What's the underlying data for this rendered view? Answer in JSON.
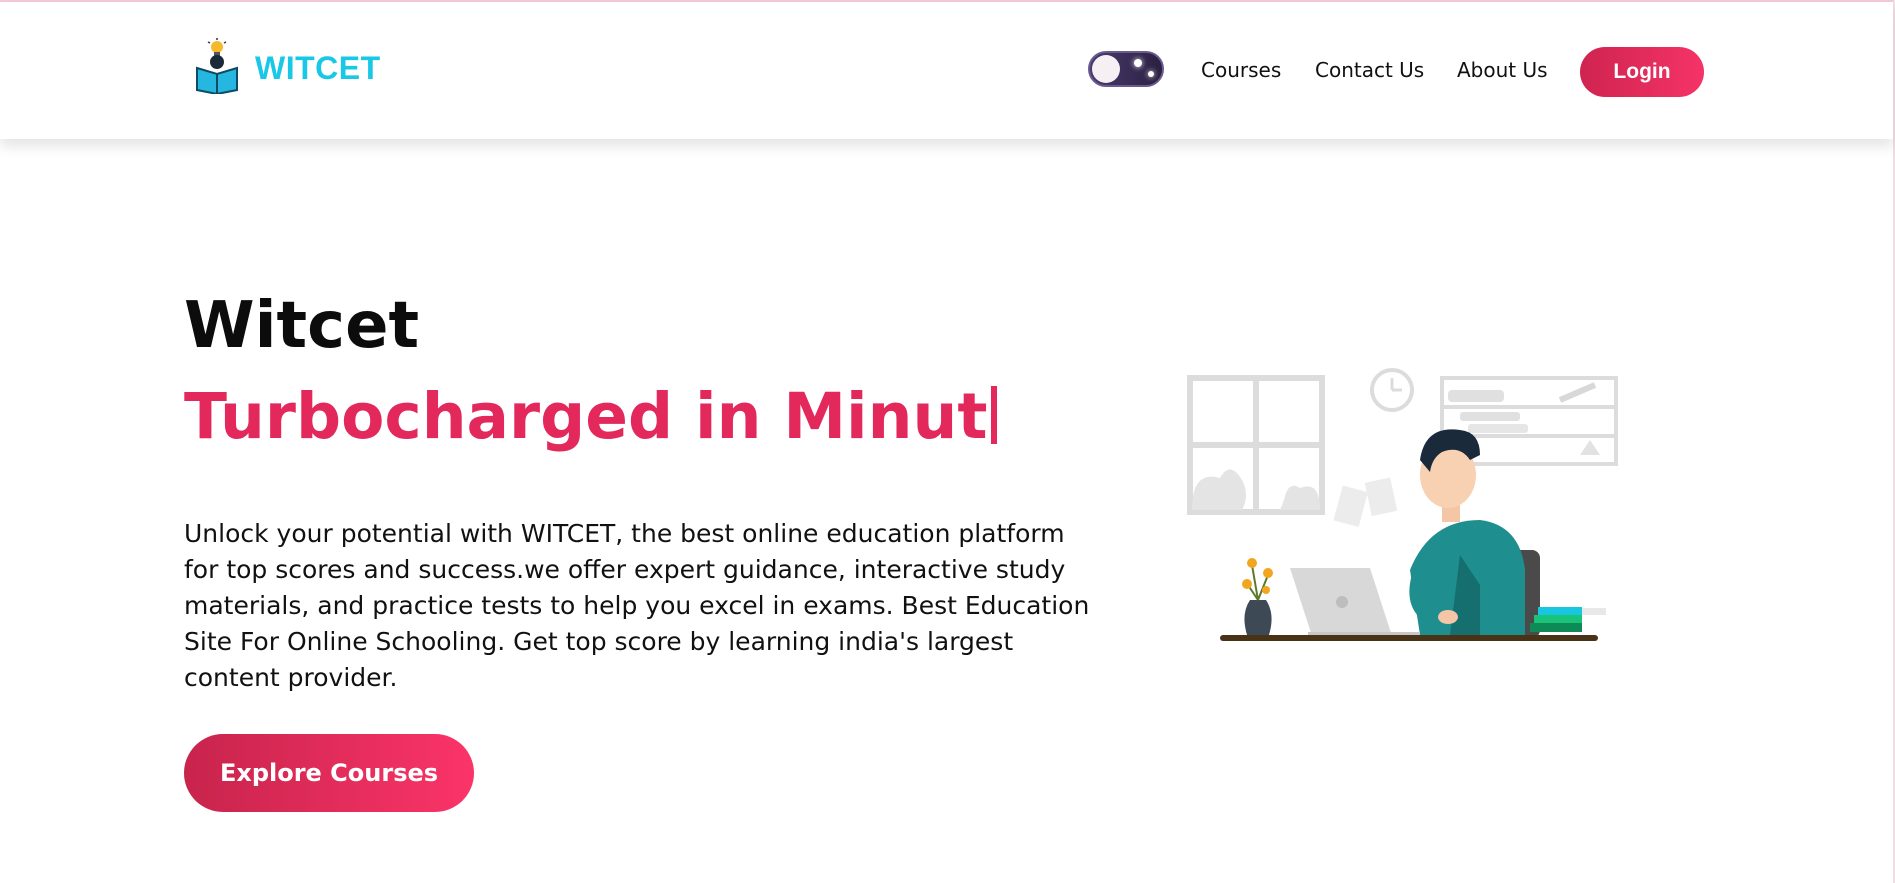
{
  "brand": {
    "name": "WITCET"
  },
  "nav": {
    "courses": "Courses",
    "contact": "Contact Us",
    "about": "About Us",
    "login": "Login"
  },
  "theme_toggle": {
    "state": "dark"
  },
  "hero": {
    "title": "Witcet",
    "subtitle": "Turbocharged in Minut",
    "description": "Unlock your potential with WITCET, the best online education platform for top scores and success.we offer expert guidance, interactive study materials, and practice tests to help you excel in exams. Best Education Site For Online Schooling. Get top score by learning india's largest content provider.",
    "cta": "Explore Courses"
  },
  "colors": {
    "brand_cyan": "#19c7e6",
    "accent_pink": "#e3285c",
    "button_gradient_start": "#c7244c",
    "button_gradient_end": "#fb3468"
  }
}
